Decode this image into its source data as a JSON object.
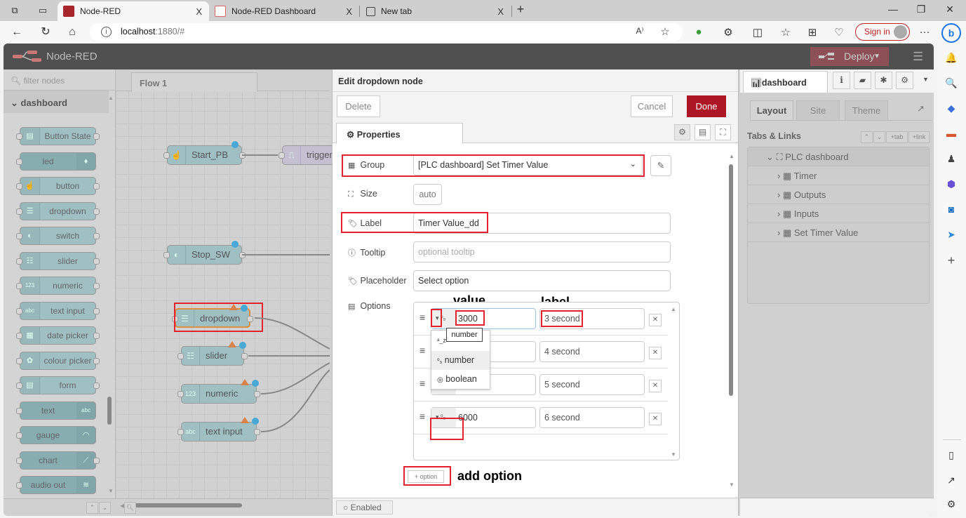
{
  "browser": {
    "tabs": [
      {
        "label": "Node-RED",
        "active": true,
        "close": "X"
      },
      {
        "label": "Node-RED Dashboard",
        "active": false,
        "close": "X"
      },
      {
        "label": "New tab",
        "active": false,
        "close": "X"
      }
    ],
    "new_tab": "+",
    "url_host": "localhost",
    "url_rest": ":1880/#",
    "sign_in": "Sign in",
    "more": "···"
  },
  "app": {
    "title": "Node-RED",
    "deploy_label": "Deploy",
    "accent": "#ad1625"
  },
  "palette": {
    "filter_placeholder": "filter nodes",
    "category": "dashboard",
    "nodes": [
      {
        "label": "Button State",
        "icon": "form-icon",
        "side": "left"
      },
      {
        "label": "led",
        "icon": "lightbulb-icon",
        "side": "right"
      },
      {
        "label": "button",
        "icon": "hand-pointer-icon",
        "side": "left"
      },
      {
        "label": "dropdown",
        "icon": "list-icon",
        "side": "left"
      },
      {
        "label": "switch",
        "icon": "toggle-icon",
        "side": "left"
      },
      {
        "label": "slider",
        "icon": "sliders-icon",
        "side": "left"
      },
      {
        "label": "numeric",
        "icon": "123-icon",
        "side": "left"
      },
      {
        "label": "text input",
        "icon": "abc-icon",
        "side": "left"
      },
      {
        "label": "date picker",
        "icon": "calendar-icon",
        "side": "left"
      },
      {
        "label": "colour picker",
        "icon": "palette-icon",
        "side": "left"
      },
      {
        "label": "form",
        "icon": "form-icon",
        "side": "left"
      },
      {
        "label": "text",
        "icon": "abc-icon",
        "side": "right"
      },
      {
        "label": "gauge",
        "icon": "gauge-icon",
        "side": "right"
      },
      {
        "label": "chart",
        "icon": "chart-icon",
        "side": "right"
      },
      {
        "label": "audio out",
        "icon": "audio-icon",
        "side": "right"
      }
    ]
  },
  "workspace": {
    "flow_tab": "Flow 1",
    "nodes": [
      {
        "label": "Start_PB"
      },
      {
        "label": "trigger"
      },
      {
        "label": "Stop_SW"
      },
      {
        "label": "dropdown"
      },
      {
        "label": "slider"
      },
      {
        "label": "numeric"
      },
      {
        "label": "text input"
      }
    ]
  },
  "tray": {
    "title": "Edit dropdown node",
    "delete": "Delete",
    "cancel": "Cancel",
    "done": "Done",
    "tab_properties": "Properties",
    "fields": {
      "group_label": "Group",
      "group_value": "[PLC dashboard] Set Timer Value",
      "size_label": "Size",
      "size_value": "auto",
      "label_label": "Label",
      "label_value": "Timer Value_dd",
      "tooltip_label": "Tooltip",
      "tooltip_placeholder": "optional tooltip",
      "placeholder_label": "Placeholder",
      "placeholder_value": "Select option",
      "options_label": "Options"
    },
    "options": [
      {
        "type": "number",
        "value": "3000",
        "label": "3 second"
      },
      {
        "type": "number",
        "value": "",
        "label": "4 second"
      },
      {
        "type": "number",
        "value": "",
        "label": "5 second"
      },
      {
        "type": "number",
        "value": "6000",
        "label": "6 second"
      }
    ],
    "type_menu": {
      "items": [
        "string",
        "number",
        "boolean"
      ],
      "visible_items": [
        "",
        "number",
        "boolean"
      ],
      "highlighted": "number",
      "tooltip": "number"
    },
    "add_option": "option",
    "enabled": "Enabled",
    "annotations": {
      "value": "value",
      "label": "label",
      "add_option": "add option"
    }
  },
  "sidebar": {
    "tab": "dashboard",
    "subtabs": [
      "Layout",
      "Site",
      "Theme"
    ],
    "active_subtab": "Layout",
    "section": "Tabs & Links",
    "section_buttons": [
      "tab",
      "link"
    ],
    "tree": {
      "tab": "PLC dashboard",
      "groups": [
        "Timer",
        "Outputs",
        "Inputs",
        "Set Timer Value"
      ]
    }
  }
}
